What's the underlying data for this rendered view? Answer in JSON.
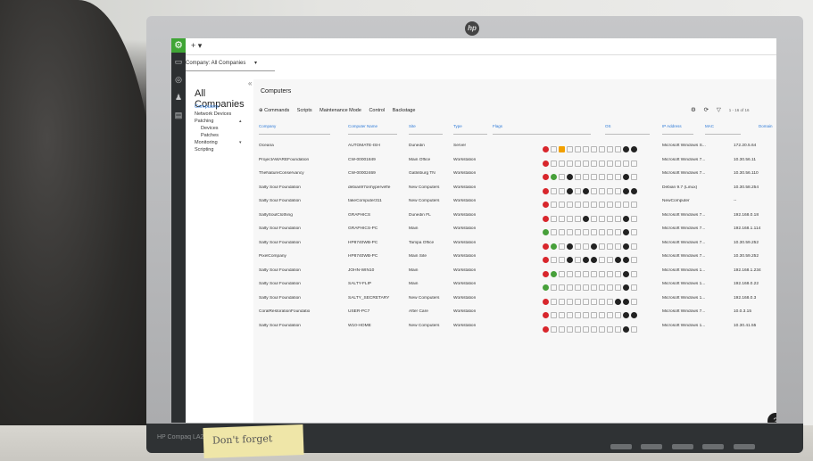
{
  "app": {
    "add_label": "+ ▾",
    "company_selector": "Company: All Companies",
    "bottom_brand": "HP Compaq LA2206"
  },
  "nav": {
    "collapse": "«",
    "title": "All Companies",
    "items": [
      {
        "label": "Computers"
      },
      {
        "label": "Network Devices"
      },
      {
        "label": "Patching"
      },
      {
        "label": "Devices"
      },
      {
        "label": "Patches"
      },
      {
        "label": "Monitoring"
      },
      {
        "label": "Scripting"
      }
    ]
  },
  "main": {
    "title": "Computers",
    "toolbar": [
      "⊕ Commands",
      "Scripts",
      "Maintenance Mode",
      "Control",
      "Backstage"
    ],
    "pager": "1 - 16 of 16"
  },
  "table": {
    "headers": [
      "Company",
      "Computer Name",
      "Site",
      "Type",
      "Flags",
      "OS",
      "IP Address",
      "MAC",
      "Domain"
    ],
    "rows": [
      {
        "company": "Oceana",
        "computer": "AUTOMATE-ISH",
        "site": "Dunedin",
        "type": "Server",
        "os": "Microsoft Windows S...",
        "ip": "172.20.5.64",
        "flags": [
          "r",
          "o",
          "y",
          "o",
          "o",
          "o",
          "o",
          "o",
          "o",
          "o",
          "d",
          "d"
        ]
      },
      {
        "company": "ProjectAWAREFoundation",
        "computer": "CW-00001849",
        "site": "Main Office",
        "type": "Workstation",
        "os": "Microsoft Windows 7...",
        "ip": "10.30.56.11",
        "flags": [
          "r",
          "o",
          "o",
          "o",
          "o",
          "o",
          "o",
          "o",
          "o",
          "o",
          "o",
          "o"
        ]
      },
      {
        "company": "TheNatureConservancy",
        "computer": "CW-00002469",
        "site": "Gatlinburg TN",
        "type": "Workstation",
        "os": "Microsoft Windows 7...",
        "ip": "10.30.56.110",
        "flags": [
          "r",
          "g",
          "o",
          "d",
          "o",
          "o",
          "o",
          "o",
          "o",
          "o",
          "d",
          "o"
        ]
      },
      {
        "company": "Salty Soul Foundation",
        "computer": "debian97onhyperveffe",
        "site": "New Computers",
        "type": "Workstation",
        "os": "Debian 9.7 (Linux)",
        "ip": "10.30.58.254",
        "flags": [
          "r",
          "o",
          "o",
          "d",
          "o",
          "d",
          "o",
          "o",
          "o",
          "o",
          "d",
          "d"
        ]
      },
      {
        "company": "Salty Soul Foundation",
        "computer": "fakeComputer311",
        "site": "New Computers",
        "type": "Workstation",
        "os": "NewComputer",
        "ip": "--",
        "flags": [
          "r",
          "o",
          "o",
          "o",
          "o",
          "o",
          "o",
          "o",
          "o",
          "o",
          "o",
          "o"
        ]
      },
      {
        "company": "SaltySoulClothing",
        "computer": "GRAPHICS",
        "site": "Dunedin FL",
        "type": "Workstation",
        "os": "Microsoft Windows 7...",
        "ip": "192.168.0.18",
        "flags": [
          "r",
          "o",
          "o",
          "o",
          "o",
          "d",
          "o",
          "o",
          "o",
          "o",
          "d",
          "o"
        ]
      },
      {
        "company": "Salty Soul Foundation",
        "computer": "GRAPHICS-PC",
        "site": "Main",
        "type": "Workstation",
        "os": "Microsoft Windows 7...",
        "ip": "192.168.1.114",
        "flags": [
          "g",
          "o",
          "o",
          "o",
          "o",
          "o",
          "o",
          "o",
          "o",
          "o",
          "d",
          "o"
        ]
      },
      {
        "company": "Salty Soul Foundation",
        "computer": "HP8740WB-PC",
        "site": "Tampa Office",
        "type": "Workstation",
        "os": "Microsoft Windows 7...",
        "ip": "10.30.59.252",
        "flags": [
          "r",
          "g",
          "o",
          "d",
          "o",
          "o",
          "d",
          "o",
          "o",
          "o",
          "d",
          "o"
        ]
      },
      {
        "company": "PixelCompany",
        "computer": "HP8740WB-PC",
        "site": "Main Site",
        "type": "Workstation",
        "os": "Microsoft Windows 7...",
        "ip": "10.30.59.252",
        "flags": [
          "r",
          "o",
          "o",
          "d",
          "o",
          "d",
          "d",
          "o",
          "o",
          "d",
          "d",
          "o"
        ]
      },
      {
        "company": "Salty Soul Foundation",
        "computer": "JOHN-WIN10",
        "site": "Main",
        "type": "Workstation",
        "os": "Microsoft Windows 1...",
        "ip": "192.168.1.234",
        "flags": [
          "r",
          "g",
          "o",
          "o",
          "o",
          "o",
          "o",
          "o",
          "o",
          "o",
          "d",
          "o"
        ]
      },
      {
        "company": "Salty Soul Foundation",
        "computer": "SALTY-FLIP",
        "site": "Main",
        "type": "Workstation",
        "os": "Microsoft Windows 1...",
        "ip": "192.168.0.22",
        "flags": [
          "g",
          "o",
          "o",
          "o",
          "o",
          "o",
          "o",
          "o",
          "o",
          "o",
          "d",
          "o"
        ]
      },
      {
        "company": "Salty Soul Foundation",
        "computer": "SALTY_SECRETARY",
        "site": "New Computers",
        "type": "Workstation",
        "os": "Microsoft Windows 1...",
        "ip": "192.168.0.3",
        "flags": [
          "r",
          "o",
          "o",
          "o",
          "o",
          "o",
          "o",
          "o",
          "o",
          "d",
          "d",
          "o"
        ]
      },
      {
        "company": "CoralRestorationFoundatio",
        "computer": "USER-PC7",
        "site": "After Care",
        "type": "Workstation",
        "os": "Microsoft Windows 7...",
        "ip": "10.0.3.15",
        "flags": [
          "r",
          "o",
          "o",
          "o",
          "o",
          "o",
          "o",
          "o",
          "o",
          "o",
          "d",
          "d"
        ]
      },
      {
        "company": "Salty Soul Foundation",
        "computer": "W10-HOME",
        "site": "New Computers",
        "type": "Workstation",
        "os": "Microsoft Windows 1...",
        "ip": "10.30.41.55",
        "flags": [
          "r",
          "o",
          "o",
          "o",
          "o",
          "o",
          "o",
          "o",
          "o",
          "o",
          "d",
          "o"
        ]
      }
    ]
  },
  "sticky_note": "Don't forget",
  "colors": {
    "brand": "#3fa535",
    "accent": "#2f7bd8",
    "alert": "#d8262c"
  }
}
